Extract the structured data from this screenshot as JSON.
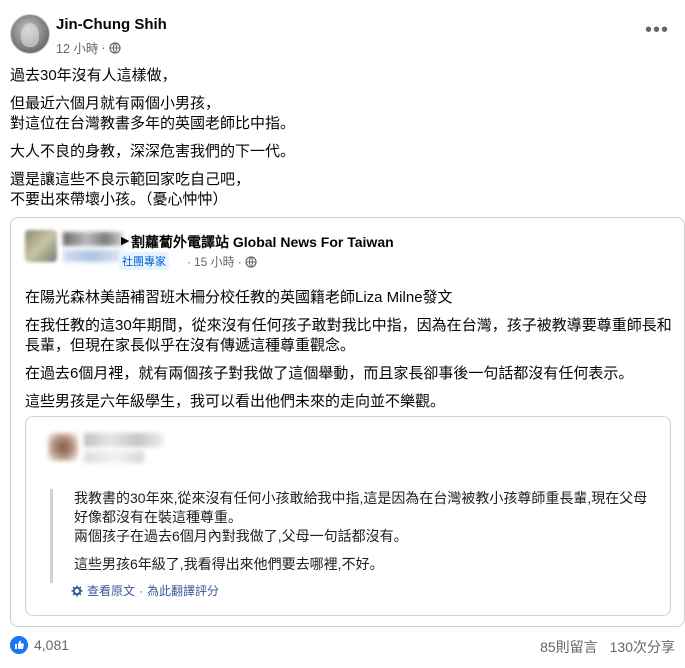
{
  "post": {
    "author": "Jin-Chung Shih",
    "time": "12 小時",
    "dot": "·",
    "paragraphs": [
      "過去30年沒有人這樣做，",
      "但最近六個月就有兩個小男孩，\n對這位在台灣教書多年的英國老師比中指。",
      "大人不良的身教，深深危害我們的下一代。",
      "還是讓這些不良示範回家吃自己吧，\n不要出來帶壞小孩。（憂心忡忡）"
    ]
  },
  "shared": {
    "separator": "▶",
    "page_name": "割蘿蔔外電譯站 Global News For Taiwan",
    "badge": "社團專家",
    "time": "15 小時",
    "dot": "·",
    "paragraphs": [
      "在陽光森林美語補習班木柵分校任教的英國籍老師Liza Milne發文",
      "在我任教的這30年期間，從來沒有任何孩子敢對我比中指，因為在台灣，孩子被教導要尊重師長和長輩，但現在家長似乎在沒有傳遞這種尊重觀念。",
      "在過去6個月裡，就有兩個孩子對我做了這個舉動，而且家長卻事後一句話都沒有任何表示。",
      "這些男孩是六年級學生，我可以看出他們未來的走向並不樂觀。"
    ]
  },
  "nested": {
    "lines": [
      "我教書的30年來,從來沒有任何小孩敢給我中指,這是因為在台灣被教小孩尊師重長輩,現在父母好像都沒有在裝這種尊重。\n兩個孩子在過去6個月內對我做了,父母一句話都沒有。",
      "這些男孩6年級了,我看得出來他們要去哪裡,不好。"
    ],
    "see_original": "查看原文",
    "separator": "·",
    "rate": "為此翻譯評分"
  },
  "footer": {
    "likes": "4,081",
    "comments": "85則留言",
    "shares": "130次分享"
  },
  "colors": {
    "text": "#050505",
    "meta": "#65676b",
    "like_blue": "#1877f2",
    "badge_bg": "#e7f3ff",
    "badge_text": "#0064d1",
    "border": "#ced0d4"
  },
  "icons": [
    "globe-icon",
    "more-icon",
    "like-icon",
    "gear-icon"
  ]
}
